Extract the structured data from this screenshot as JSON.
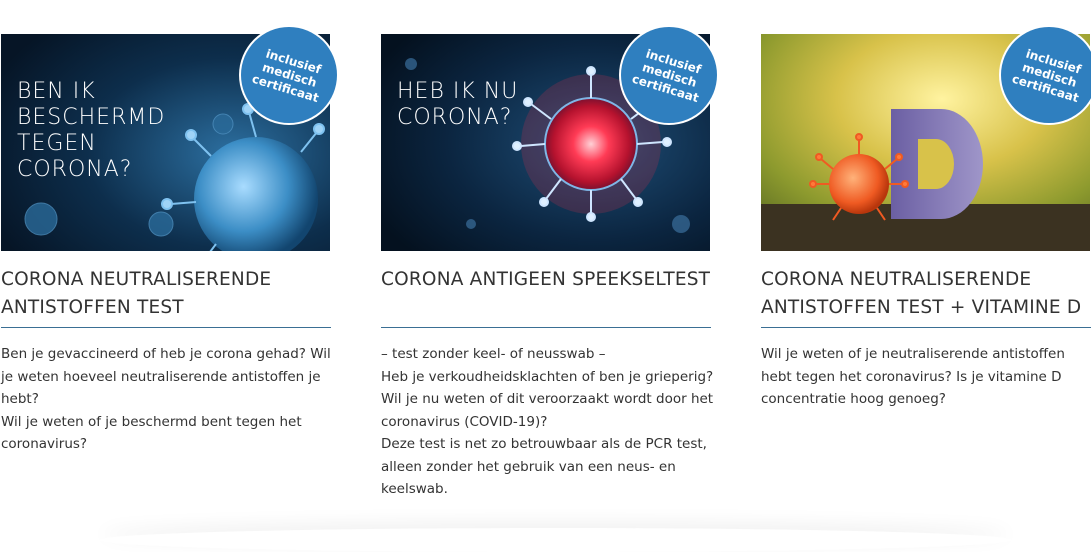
{
  "cards": [
    {
      "image_text": "BEN IK\nBESCHERMD\nTEGEN\nCORONA?",
      "badge": "inclusief\nmedisch\ncertificaat",
      "title": "CORONA NEUTRALISERENDE ANTISTOFFEN TEST",
      "description": [
        "Ben je gevaccineerd of heb je corona gehad? Wil je weten hoeveel neutraliserende antistoffen je hebt?",
        "Wil je weten of je beschermd bent tegen het coronavirus?"
      ]
    },
    {
      "image_text": "HEB IK NU\nCORONA?",
      "badge": "inclusief\nmedisch\ncertificaat",
      "title": "CORONA ANTIGEEN SPEEKSELTEST",
      "description": [
        "– test zonder keel- of neusswab –",
        "Heb je verkoudheidsklachten of ben je grieperig? Wil je nu weten of dit veroorzaakt wordt door het coronavirus (COVID-19)?",
        "Deze test is net zo betrouwbaar als de PCR test, alleen zonder het gebruik van een neus- en keelswab."
      ]
    },
    {
      "image_text": "",
      "badge": "inclusief\nmedisch\ncertificaat",
      "title": "CORONA NEUTRALISERENDE ANTISTOFFEN TEST + VITAMINE D",
      "description": [
        "Wil je weten of je neutraliserende antistoffen hebt tegen het coronavirus? Is je vitamine D concentratie hoog genoeg?"
      ]
    }
  ],
  "colors": {
    "badge": "#2f7fbf",
    "rule": "#3a6f94",
    "text": "#333333"
  }
}
